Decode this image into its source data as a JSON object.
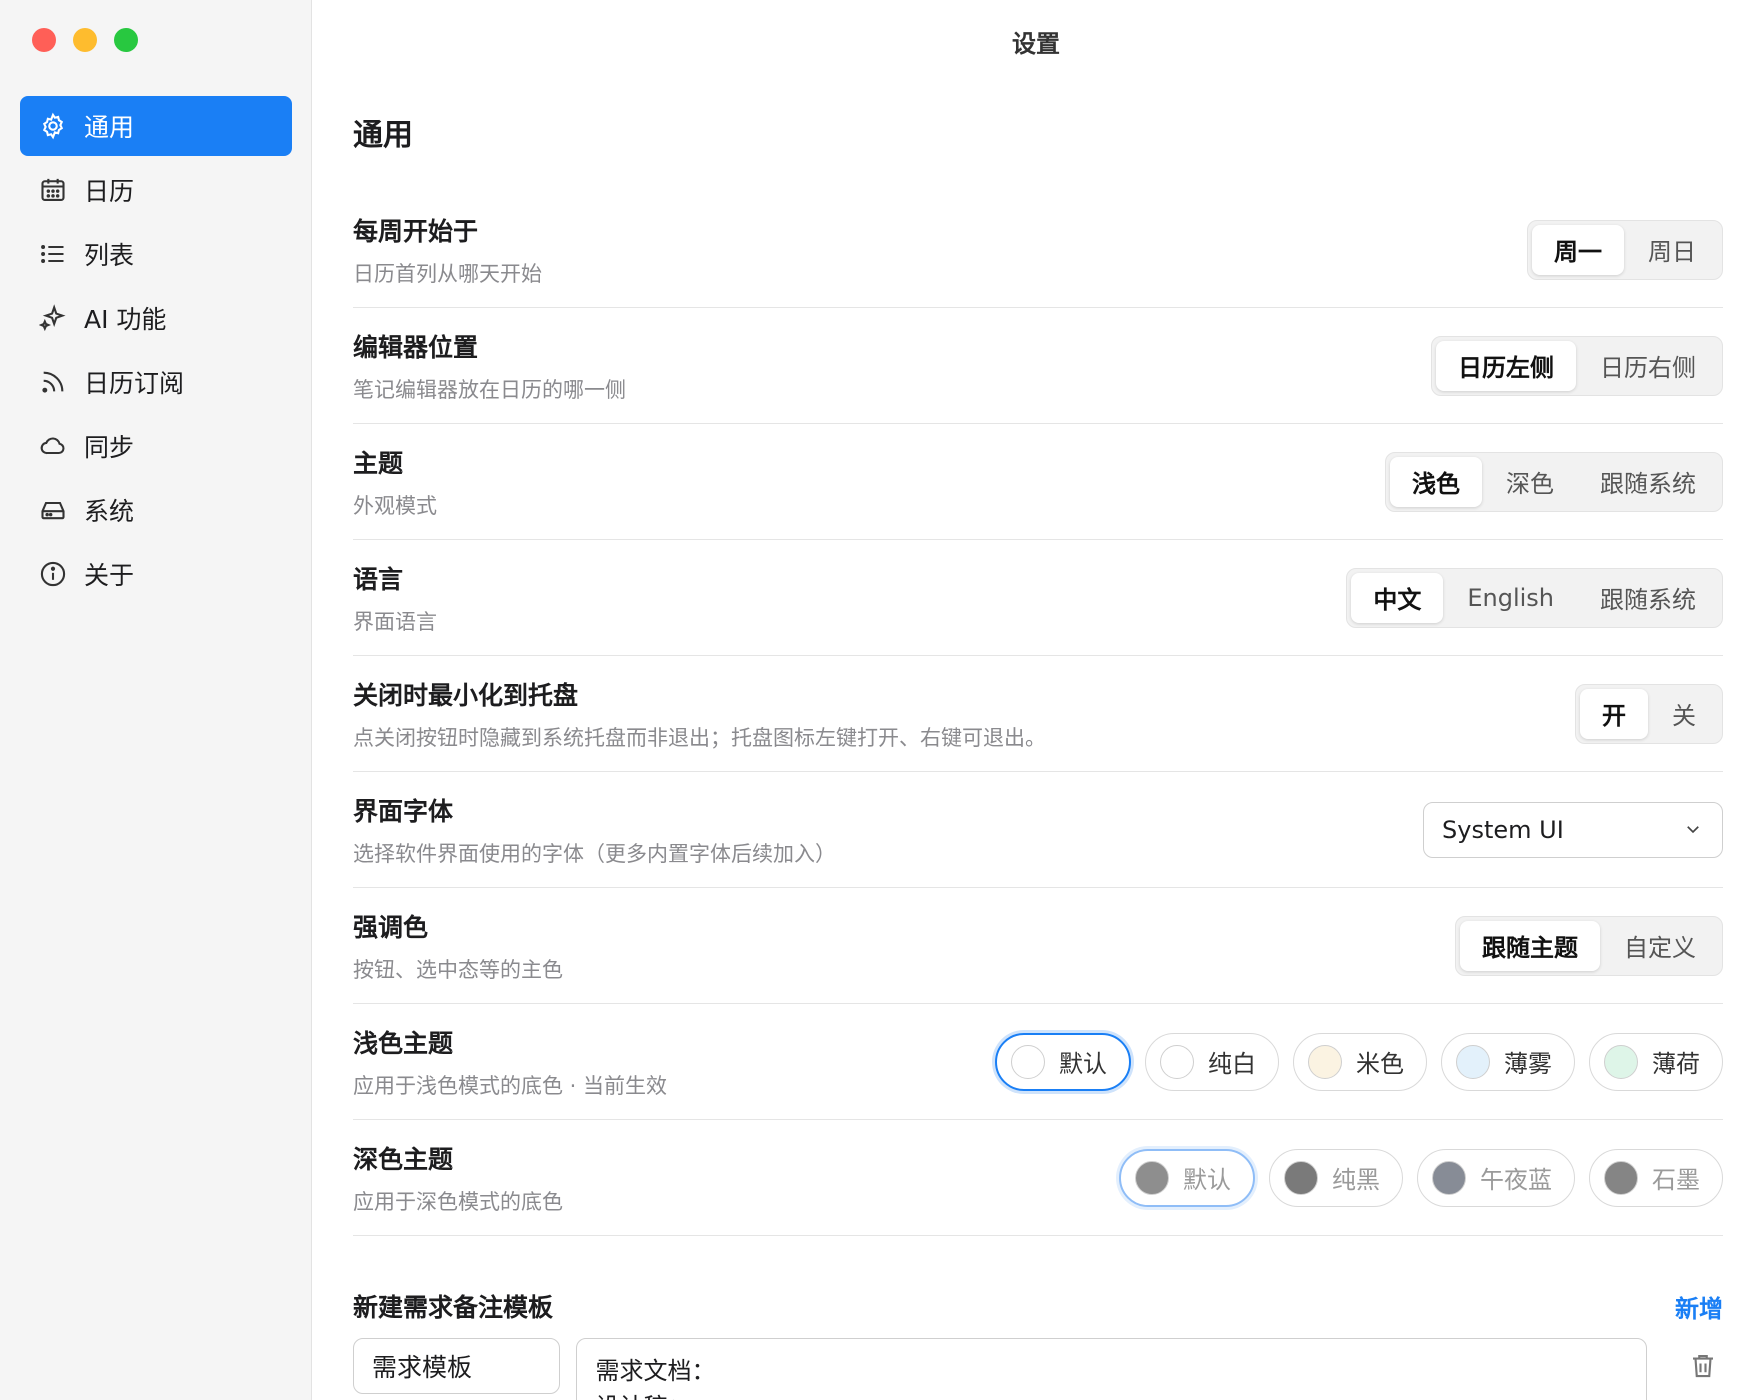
{
  "window": {
    "title": "设置"
  },
  "sidebar": {
    "items": [
      {
        "label": "通用",
        "icon": "gear-icon",
        "active": true
      },
      {
        "label": "日历",
        "icon": "calendar-icon"
      },
      {
        "label": "列表",
        "icon": "list-icon"
      },
      {
        "label": "AI 功能",
        "icon": "sparkle-icon"
      },
      {
        "label": "日历订阅",
        "icon": "rss-icon"
      },
      {
        "label": "同步",
        "icon": "cloud-icon"
      },
      {
        "label": "系统",
        "icon": "drive-icon"
      },
      {
        "label": "关于",
        "icon": "info-icon"
      }
    ]
  },
  "main": {
    "section_title": "通用",
    "week_start": {
      "label": "每周开始于",
      "desc": "日历首列从哪天开始",
      "options": [
        "周一",
        "周日"
      ],
      "selected": "周一"
    },
    "editor_position": {
      "label": "编辑器位置",
      "desc": "笔记编辑器放在日历的哪一侧",
      "options": [
        "日历左侧",
        "日历右侧"
      ],
      "selected": "日历左侧"
    },
    "theme": {
      "label": "主题",
      "desc": "外观模式",
      "options": [
        "浅色",
        "深色",
        "跟随系统"
      ],
      "selected": "浅色"
    },
    "language": {
      "label": "语言",
      "desc": "界面语言",
      "options": [
        "中文",
        "English",
        "跟随系统"
      ],
      "selected": "中文"
    },
    "minimize_tray": {
      "label": "关闭时最小化到托盘",
      "desc": "点关闭按钮时隐藏到系统托盘而非退出；托盘图标左键打开、右键可退出。",
      "options": [
        "开",
        "关"
      ],
      "selected": "开"
    },
    "font": {
      "label": "界面字体",
      "desc": "选择软件界面使用的字体（更多内置字体后续加入）",
      "value": "System UI"
    },
    "accent": {
      "label": "强调色",
      "desc": "按钮、选中态等的主色",
      "options": [
        "跟随主题",
        "自定义"
      ],
      "selected": "跟随主题"
    },
    "light_theme": {
      "label": "浅色主题",
      "desc": "应用于浅色模式的底色 · 当前生效",
      "swatches": [
        {
          "name": "默认",
          "color": "#ffffff",
          "selected": true
        },
        {
          "name": "纯白",
          "color": "#ffffff"
        },
        {
          "name": "米色",
          "color": "#fbf3e2"
        },
        {
          "name": "薄雾",
          "color": "#e3f1fb"
        },
        {
          "name": "薄荷",
          "color": "#def5e8"
        }
      ]
    },
    "dark_theme": {
      "label": "深色主题",
      "desc": "应用于深色模式的底色",
      "swatches": [
        {
          "name": "默认",
          "color": "#8e8e8e",
          "selected": true
        },
        {
          "name": "纯黑",
          "color": "#7a7a7a"
        },
        {
          "name": "午夜蓝",
          "color": "#878c96"
        },
        {
          "name": "石墨",
          "color": "#858585"
        }
      ]
    },
    "templates": {
      "title": "新建需求备注模板",
      "add_label": "新增",
      "items": [
        {
          "name": "需求模板",
          "content_lines": [
            "需求文档：",
            "设计稿："
          ]
        }
      ]
    }
  }
}
